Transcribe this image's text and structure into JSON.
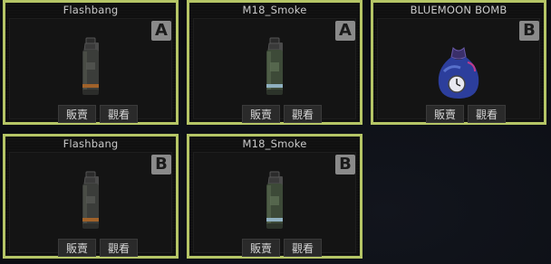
{
  "cards": [
    {
      "title": "Flashbang",
      "grade": "A",
      "item": "flashbang-grenade-icon",
      "sell_label": "販賣",
      "view_label": "觀看"
    },
    {
      "title": "M18_Smoke",
      "grade": "A",
      "item": "smoke-grenade-icon",
      "sell_label": "販賣",
      "view_label": "觀看"
    },
    {
      "title": "BLUEMOON BOMB",
      "grade": "B",
      "item": "bluemoon-bomb-icon",
      "sell_label": "販賣",
      "view_label": "觀看"
    },
    {
      "title": "Flashbang",
      "grade": "B",
      "item": "flashbang-grenade-icon",
      "sell_label": "販賣",
      "view_label": "觀看"
    },
    {
      "title": "M18_Smoke",
      "grade": "B",
      "item": "smoke-grenade-icon",
      "sell_label": "販賣",
      "view_label": "觀看"
    }
  ],
  "colors": {
    "card_border": "#b5c566",
    "grade_badge": "#8a8a8a",
    "background": "#0d0f14"
  }
}
